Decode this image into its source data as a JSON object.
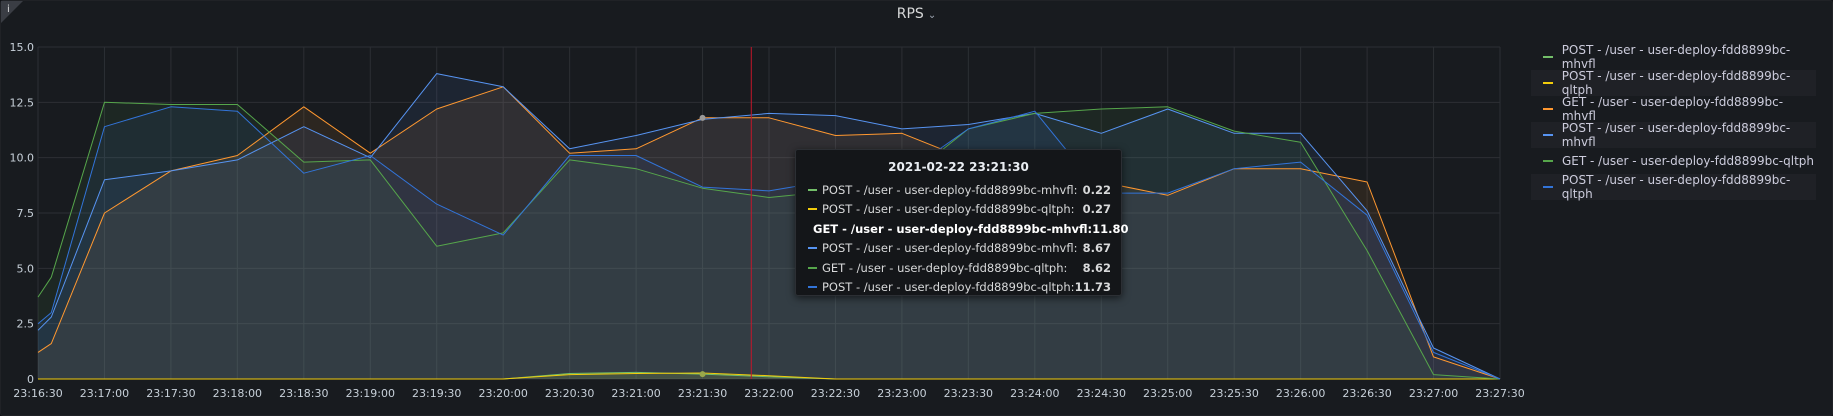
{
  "panel": {
    "title": "RPS",
    "info_icon": "i"
  },
  "chart_data": {
    "type": "area",
    "title": "RPS",
    "xlabel": "",
    "ylabel": "",
    "ylim": [
      0,
      15
    ],
    "yticks": [
      "0",
      "2.5",
      "5.0",
      "7.5",
      "10.0",
      "12.5",
      "15.0"
    ],
    "xlim": [
      "23:16:30",
      "23:27:30"
    ],
    "xticks": [
      "23:16:30",
      "23:17:00",
      "23:17:30",
      "23:18:00",
      "23:18:30",
      "23:19:00",
      "23:19:30",
      "23:20:00",
      "23:20:30",
      "23:21:00",
      "23:21:30",
      "23:22:00",
      "23:22:30",
      "23:23:00",
      "23:23:30",
      "23:24:00",
      "23:24:30",
      "23:25:00",
      "23:25:30",
      "23:26:00",
      "23:26:30",
      "23:27:00",
      "23:27:30"
    ],
    "grid": true,
    "legend_position": "right",
    "x": [
      "23:16:30",
      "23:16:36",
      "23:17:00",
      "23:17:30",
      "23:18:00",
      "23:18:30",
      "23:19:00",
      "23:19:30",
      "23:20:00",
      "23:20:30",
      "23:21:00",
      "23:21:30",
      "23:22:00",
      "23:22:30",
      "23:23:00",
      "23:23:30",
      "23:24:00",
      "23:24:30",
      "23:25:00",
      "23:25:30",
      "23:26:00",
      "23:26:30",
      "23:27:00",
      "23:27:30"
    ],
    "series": [
      {
        "name": "POST - /user - user-deploy-fdd8899bc-mhvfl",
        "color": "#73bf69",
        "values": [
          0,
          0,
          0,
          0,
          0,
          0,
          0,
          0,
          0,
          0.25,
          0.3,
          0.22,
          0.1,
          0,
          0,
          0,
          0,
          0,
          0,
          0,
          0,
          0,
          0,
          0
        ]
      },
      {
        "name": "POST - /user - user-deploy-fdd8899bc-qltph",
        "color": "#f2cc0c",
        "values": [
          0,
          0,
          0,
          0,
          0,
          0,
          0,
          0,
          0,
          0.2,
          0.25,
          0.27,
          0.15,
          0,
          0,
          0,
          0,
          0,
          0,
          0,
          0,
          0,
          0,
          0
        ]
      },
      {
        "name": "GET - /user - user-deploy-fdd8899bc-mhvfl",
        "color": "#ff9830",
        "values": [
          1.2,
          1.6,
          7.5,
          9.4,
          10.1,
          12.3,
          10.2,
          12.2,
          13.2,
          10.2,
          10.4,
          11.8,
          11.8,
          11.0,
          11.1,
          9.9,
          9.1,
          8.9,
          8.3,
          9.5,
          9.5,
          8.9,
          1.0,
          0
        ]
      },
      {
        "name": "POST - /user - user-deploy-fdd8899bc-mhvfl",
        "color": "#5794f2",
        "values": [
          2.2,
          2.8,
          9.0,
          9.4,
          9.9,
          11.4,
          10.0,
          13.8,
          13.2,
          10.4,
          11.0,
          11.73,
          12.0,
          11.9,
          11.3,
          11.5,
          12.0,
          11.1,
          12.2,
          11.1,
          11.1,
          7.6,
          1.4,
          0
        ]
      },
      {
        "name": "GET - /user - user-deploy-fdd8899bc-qltph",
        "color": "#56a64b",
        "values": [
          3.7,
          4.6,
          12.5,
          12.4,
          12.4,
          9.8,
          9.9,
          6.0,
          6.6,
          9.9,
          9.5,
          8.62,
          8.2,
          8.5,
          8.9,
          11.3,
          12.0,
          12.2,
          12.3,
          11.2,
          10.7,
          5.8,
          0.2,
          0
        ]
      },
      {
        "name": "POST - /user - user-deploy-fdd8899bc-qltph",
        "color": "#3274d9",
        "values": [
          2.5,
          3.0,
          11.4,
          12.3,
          12.1,
          9.3,
          10.1,
          7.9,
          6.5,
          10.1,
          10.1,
          8.67,
          8.5,
          9.0,
          9.2,
          11.3,
          12.1,
          8.4,
          8.4,
          9.5,
          9.8,
          7.4,
          1.2,
          0
        ]
      }
    ],
    "cursor_time": "23:21:52",
    "tooltip": {
      "time": "2021-02-22 23:21:30",
      "rows": [
        {
          "label": "POST - /user - user-deploy-fdd8899bc-mhvfl:",
          "value": "0.22",
          "color": "#73bf69",
          "bold": false
        },
        {
          "label": "POST - /user - user-deploy-fdd8899bc-qltph:",
          "value": "0.27",
          "color": "#f2cc0c",
          "bold": false
        },
        {
          "label": "GET - /user - user-deploy-fdd8899bc-mhvfl:",
          "value": "11.80",
          "color": "#ff9830",
          "bold": true
        },
        {
          "label": "POST - /user - user-deploy-fdd8899bc-mhvfl:",
          "value": "8.67",
          "color": "#5794f2",
          "bold": false
        },
        {
          "label": "GET - /user - user-deploy-fdd8899bc-qltph:",
          "value": "8.62",
          "color": "#56a64b",
          "bold": false
        },
        {
          "label": "POST - /user - user-deploy-fdd8899bc-qltph:",
          "value": "11.73",
          "color": "#3274d9",
          "bold": false
        }
      ]
    }
  },
  "legend": {
    "items": [
      {
        "label": "POST - /user - user-deploy-fdd8899bc-mhvfl",
        "color": "#73bf69"
      },
      {
        "label": "POST - /user - user-deploy-fdd8899bc-qltph",
        "color": "#f2cc0c"
      },
      {
        "label": "GET - /user - user-deploy-fdd8899bc-mhvfl",
        "color": "#ff9830"
      },
      {
        "label": "POST - /user - user-deploy-fdd8899bc-mhvfl",
        "color": "#5794f2"
      },
      {
        "label": "GET - /user - user-deploy-fdd8899bc-qltph",
        "color": "#56a64b"
      },
      {
        "label": "POST - /user - user-deploy-fdd8899bc-qltph",
        "color": "#3274d9"
      }
    ]
  },
  "colors": {
    "grid": "#2c2f34",
    "cursor": "#c4162a",
    "text": "#c7d0d9"
  }
}
